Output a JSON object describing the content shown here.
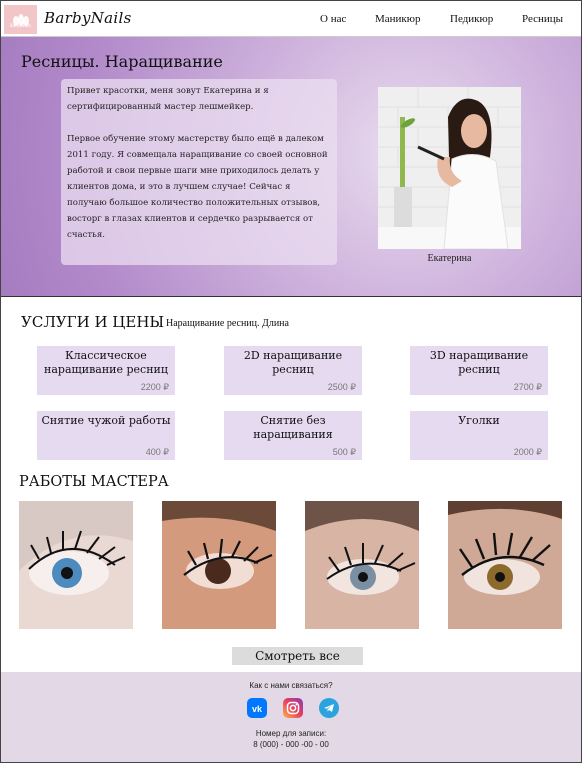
{
  "header": {
    "logo_text": "BarbyNails",
    "logo_badge_text": "BarbyNails",
    "nav": [
      "О нас",
      "Маникюр",
      "Педикюр",
      "Ресницы"
    ]
  },
  "hero": {
    "title": "Ресницы. Наращивание",
    "paragraph1": "Привет красотки, меня зовут Екатерина  и я сертифицированный мастер лешмейкер.",
    "paragraph2": "Первое обучение этому мастерству было ещё в далеком 2011 году. Я совмещала наращивание со своей основной работой и свои первые шаги мне приходилось делать у клиентов дома, и это в лучшем случае! Сейчас я получаю большое количество положительных отзывов, восторг в глазах клиентов и сердечко разрывается от счастья.",
    "photo_caption": "Екатерина"
  },
  "services": {
    "title": "УСЛУГИ И ЦЕНЫ",
    "subtitle": "Наращивание ресниц. Длина",
    "items": [
      {
        "name": "Классическое наращивание ресниц",
        "price": "2200 ₽"
      },
      {
        "name": "2D наращивание ресниц",
        "price": "2500 ₽"
      },
      {
        "name": "3D наращивание ресниц",
        "price": "2700 ₽"
      },
      {
        "name": "Снятие чужой работы",
        "price": "400 ₽"
      },
      {
        "name": "Снятие без наращивания",
        "price": "500 ₽"
      },
      {
        "name": "Уголки",
        "price": "2000 ₽"
      }
    ],
    "card_color": "#e6daf0"
  },
  "works": {
    "title": "РАБОТЫ МАСТЕРА",
    "see_all_label": "Смотреть все"
  },
  "footer": {
    "question": "Как с нами связаться?",
    "socials": [
      "vk-icon",
      "instagram-icon",
      "telegram-icon"
    ],
    "phone_label": "Номер для записи:",
    "phone": "8 (000) - 000 -00 - 00"
  },
  "colors": {
    "hero_purple": "#b38bcb",
    "footer_bg": "#e3d9e6",
    "vk_blue": "#0077ff",
    "telegram_blue": "#2aa3df"
  }
}
